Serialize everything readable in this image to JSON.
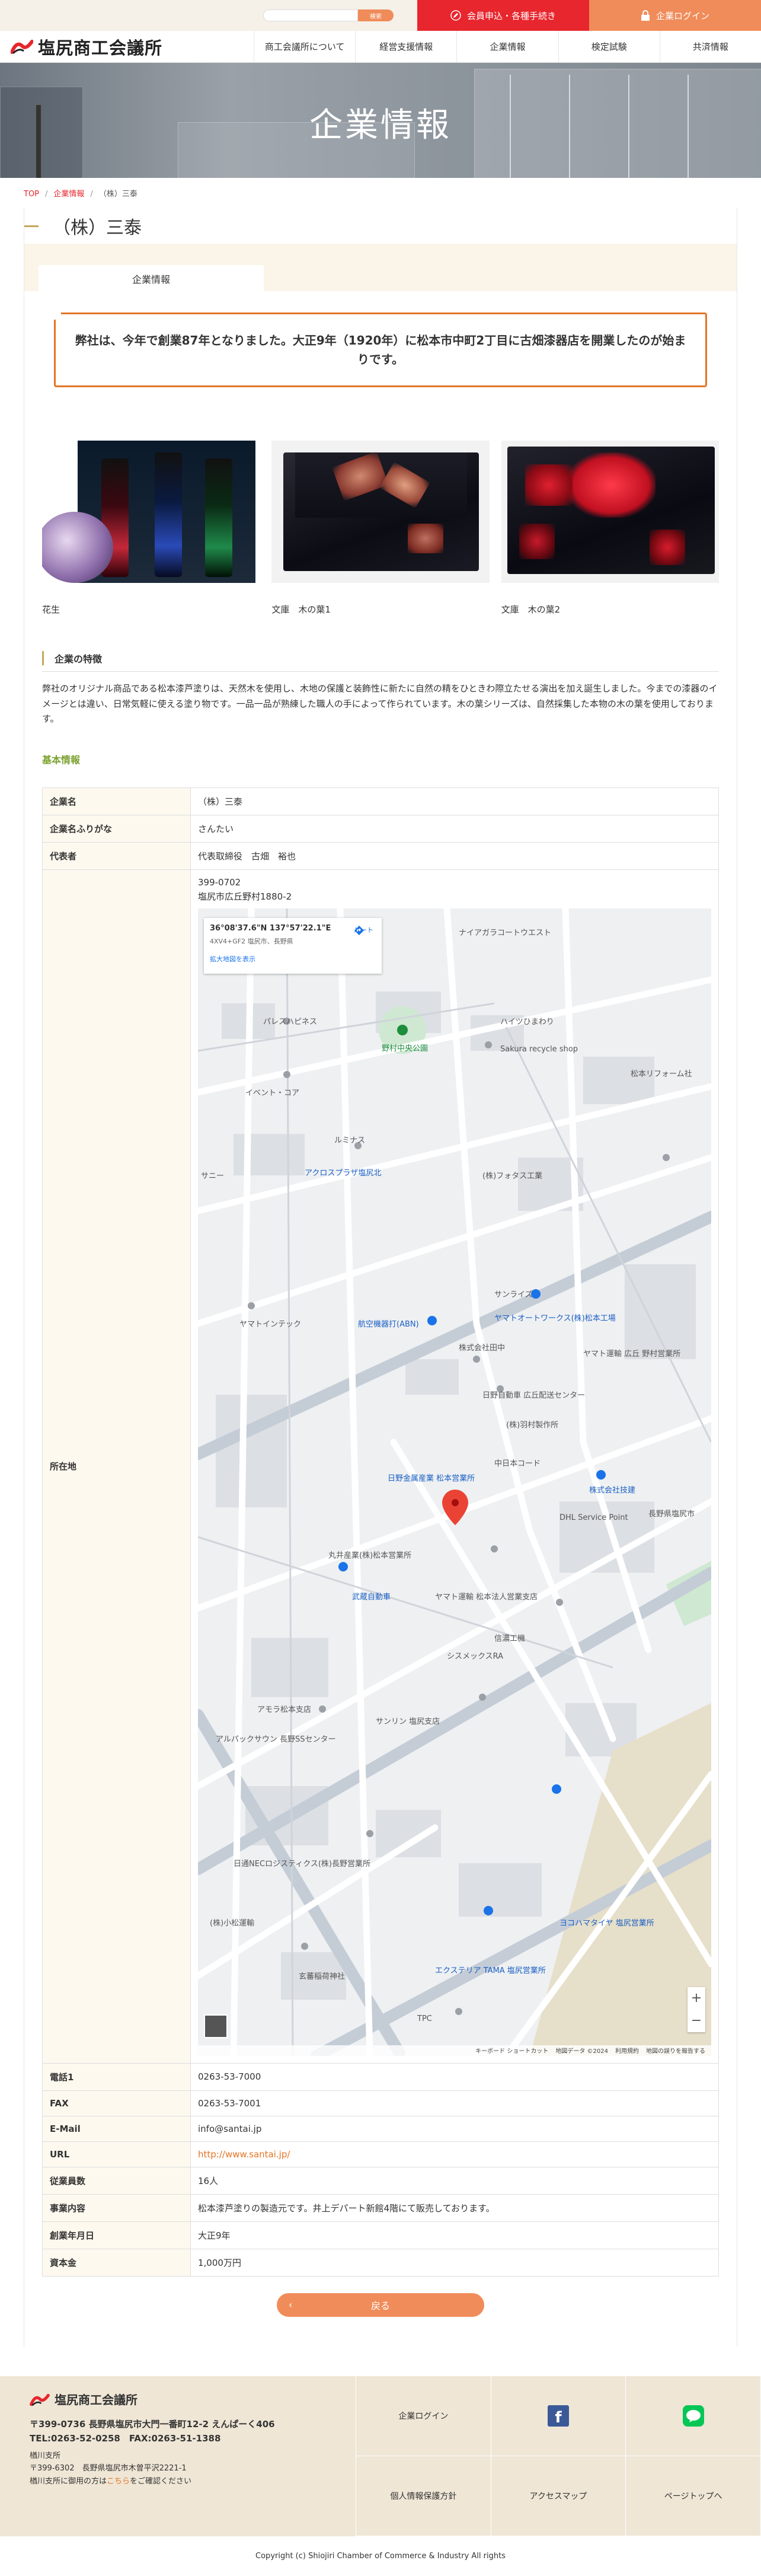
{
  "topbar": {
    "search_placeholder": "",
    "search_button": "検索",
    "member_label": "会員申込・各種手続き",
    "login_label": "企業ログイン"
  },
  "header": {
    "logo_text": "塩尻商工会議所",
    "nav": [
      "商工会議所について",
      "経営支援情報",
      "企業情報",
      "検定試験",
      "共済情報"
    ]
  },
  "hero": {
    "title": "企業情報"
  },
  "breadcrumb": {
    "top": "TOP",
    "section": "企業情報",
    "current": "（株）三泰"
  },
  "company": {
    "name": "（株）三泰",
    "tab": "企業情報",
    "catch": "弊社は、今年で創業87年となりました。大正9年（1920年）に松本市中町2丁目に古畑漆器店を開業したのが始まりです。"
  },
  "gallery": [
    {
      "caption": "花生"
    },
    {
      "caption": "文庫　木の葉1"
    },
    {
      "caption": "文庫　木の葉2"
    }
  ],
  "features": {
    "heading": "企業の特徴",
    "text": "弊社のオリジナル商品である松本漆芦塗りは、天然木を使用し、木地の保護と装飾性に新たに自然の精をひときわ際立たせる演出を加え誕生しました。今までの漆器のイメージとは違い、日常気軽に使える塗り物です。一品一品が熟練した職人の手によって作られています。木の葉シリーズは、自然採集した本物の木の葉を使用しております。"
  },
  "basic": {
    "heading": "基本情報",
    "rows_top": [
      {
        "label": "企業名",
        "value": "（株）三泰"
      },
      {
        "label": "企業名ふりがな",
        "value": "さんたい"
      },
      {
        "label": "代表者",
        "value": "代表取締役　古畑　裕也"
      }
    ],
    "address_label": "所在地",
    "postal": "399-0702",
    "address": "塩尻市広丘野村1880-2",
    "rows_bottom": [
      {
        "label": "電話1",
        "value": "0263-53-7000"
      },
      {
        "label": "FAX",
        "value": "0263-53-7001"
      },
      {
        "label": "E-Mail",
        "value": "info@santai.jp"
      },
      {
        "label": "URL",
        "value": "http://www.santai.jp/"
      },
      {
        "label": "従業員数",
        "value": "16人"
      },
      {
        "label": "事業内容",
        "value": "松本漆芦塗りの製造元です。井上デパート新館4階にて販売しております。"
      },
      {
        "label": "創業年月日",
        "value": "大正9年"
      },
      {
        "label": "資本金",
        "value": "1,000万円"
      }
    ]
  },
  "map": {
    "coord": "36°08'37.6\"N 137°57'22.1\"E",
    "plus_code": "4XV4+GF2 塩尻市、長野県",
    "route": "ルート",
    "large_map": "拡大地図を表示",
    "footer": [
      "キーボード ショートカット",
      "地図データ ©2024",
      "利用規約",
      "地図の誤りを報告する"
    ],
    "labels": [
      "ナイアガラコートウエスト",
      "パレスハピネス",
      "野村中央公園",
      "ハイツひまわり",
      "Sakura recycle shop",
      "イベント・コア",
      "松本リフォーム社",
      "ルミナス",
      "アクロスプラザ塩尻北",
      "(株)フォタス工業",
      "サンライズ",
      "サニー",
      "ヤマトインテック",
      "航空機器打(ABN)",
      "ヤマトオートワークス(株)松本工場",
      "株式会社田中",
      "ヤマト運輸 広丘 野村営業所",
      "日野自動車 広丘配送センター",
      "(株)羽村製作所",
      "中日本コード",
      "日野金属産業 松本営業所",
      "株式会社技建",
      "DHL Service Point",
      "長野県塩尻市",
      "丸井産業(株)松本営業所",
      "武蔵自動車",
      "ヤマト運輸 松本法人営業支店",
      "信濃工機",
      "シスメックスRA",
      "アモラ松本支店",
      "サンリン 塩尻支店",
      "アルパックサウン 長野SSセンター",
      "日通NECロジスティクス(株)長野営業所",
      "(株)小松運輸",
      "玄蕃稲荷神社",
      "ヨコハマタイヤ 塩尻営業所",
      "エクステリア TAMA 塩尻営業所",
      "TPC"
    ]
  },
  "back_button": "戻る",
  "footer": {
    "logo": "塩尻商工会議所",
    "address": "〒399-0736 長野県塩尻市大門一番町12-2 えんぱーく406",
    "tel": "TEL:0263-52-0258　FAX:0263-51-1388",
    "branch1": "楢川支所",
    "branch2": "〒399-6302　長野県塩尻市木曽平沢2221-1",
    "branch3_pre": "楢川支所に御用の方は",
    "branch3_link": "こちら",
    "branch3_post": "をご確認ください",
    "links": [
      "企業ログイン",
      "個人情報保護方針",
      "アクセスマップ",
      "ページトップへ"
    ],
    "copyright": "Copyright (c) Shiojiri Chamber of Commerce & Industry All rights"
  }
}
